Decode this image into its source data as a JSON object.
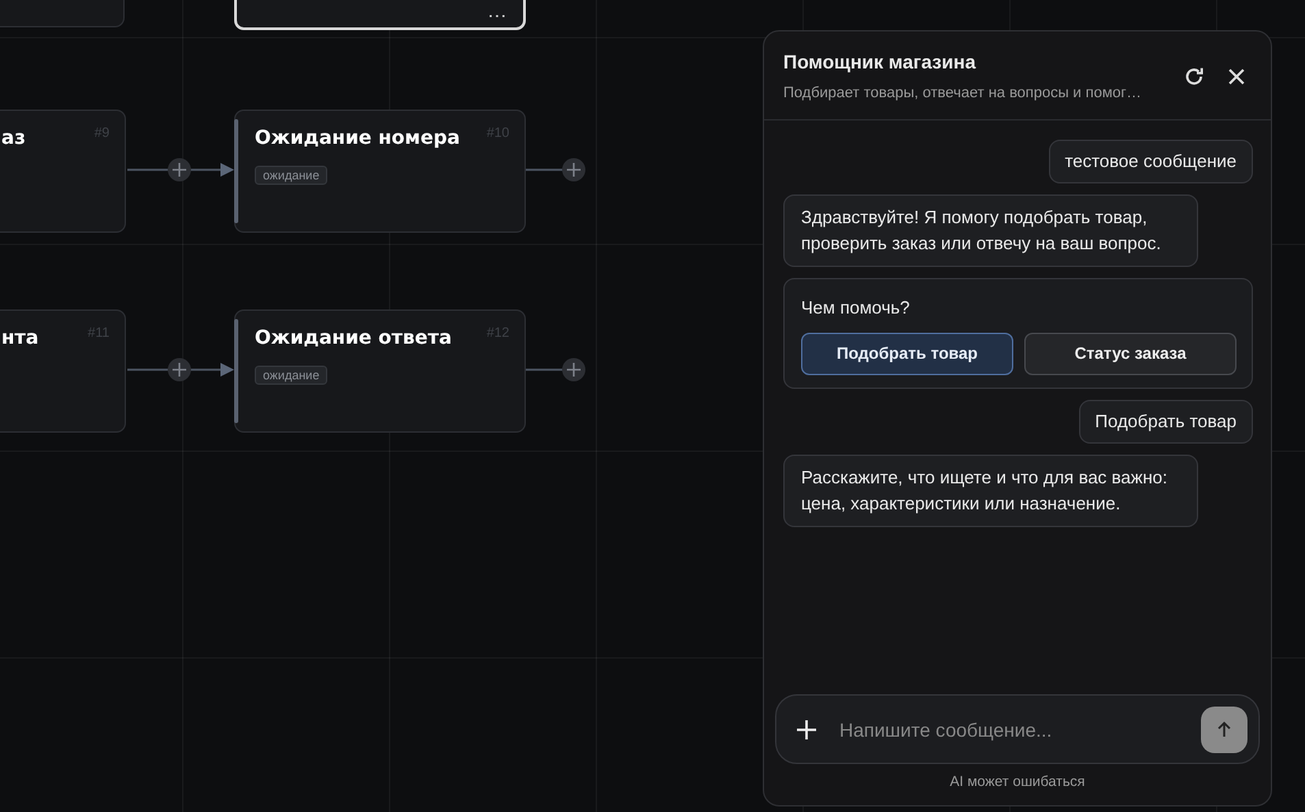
{
  "canvas": {
    "nodes": [
      {
        "kind": "stub",
        "selected": false
      },
      {
        "kind": "menu",
        "menu": "⋯",
        "selected": true
      },
      {
        "kind": "clipped",
        "title": "аз",
        "number": "#9",
        "selected": false
      },
      {
        "kind": "node",
        "title": "Ожидание номера",
        "number": "#10",
        "tag": "ожидание",
        "selected": false
      },
      {
        "kind": "clipped",
        "title": "нта",
        "number": "#11",
        "selected": false
      },
      {
        "kind": "node",
        "title": "Ожидание ответа",
        "number": "#12",
        "tag": "ожидание",
        "selected": false
      }
    ]
  },
  "chat": {
    "title": "Помощник магазина",
    "subtitle": "Подбирает товары, отвечает на вопросы и помог…",
    "messages": [
      {
        "kind": "user",
        "text": "тестовое сообщение"
      },
      {
        "kind": "bot",
        "text": "Здравствуйте! Я помогу подобрать товар, проверить заказ или отвечу на ваш вопрос."
      },
      {
        "kind": "choices",
        "text": "Чем помочь?",
        "options": [
          {
            "label": "Подобрать товар",
            "selected": true
          },
          {
            "label": "Статус заказа",
            "selected": false
          }
        ]
      },
      {
        "kind": "user",
        "text": "Подобрать товар"
      },
      {
        "kind": "bot",
        "text": "Расскажите, что ищете и что для вас важно: цена, характеристики или назначение."
      }
    ],
    "input": {
      "placeholder": "Напишите сообщение..."
    },
    "disclaimer": "AI может ошибаться"
  }
}
